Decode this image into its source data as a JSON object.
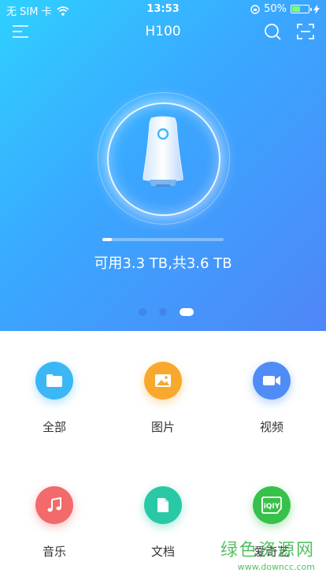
{
  "status_bar": {
    "carrier": "无 SIM 卡",
    "time": "13:53",
    "battery": "50%",
    "battery_level": 0.5
  },
  "header": {
    "title": "H100",
    "menu_icon": "menu-icon",
    "search_icon": "search-icon",
    "scan_icon": "scan-icon"
  },
  "device": {
    "storage_text": "可用3.3 TB,共3.6 TB",
    "storage_used_fraction": 0.08
  },
  "carousel": {
    "pages": 3,
    "active_index": 2
  },
  "categories": [
    {
      "label": "全部",
      "icon": "folder-icon",
      "color": "#3bb7f5"
    },
    {
      "label": "图片",
      "icon": "image-icon",
      "color": "#f8a92d"
    },
    {
      "label": "视频",
      "icon": "video-icon",
      "color": "#4f8cf6"
    },
    {
      "label": "音乐",
      "icon": "music-icon",
      "color": "#f26a6a"
    },
    {
      "label": "文档",
      "icon": "document-icon",
      "color": "#2ac9a6"
    },
    {
      "label": "爱奇艺",
      "icon": "iqiyi-icon",
      "color": "#38c14a"
    }
  ],
  "watermark": {
    "text": "绿色资源网",
    "url": "www.downcc.com"
  }
}
